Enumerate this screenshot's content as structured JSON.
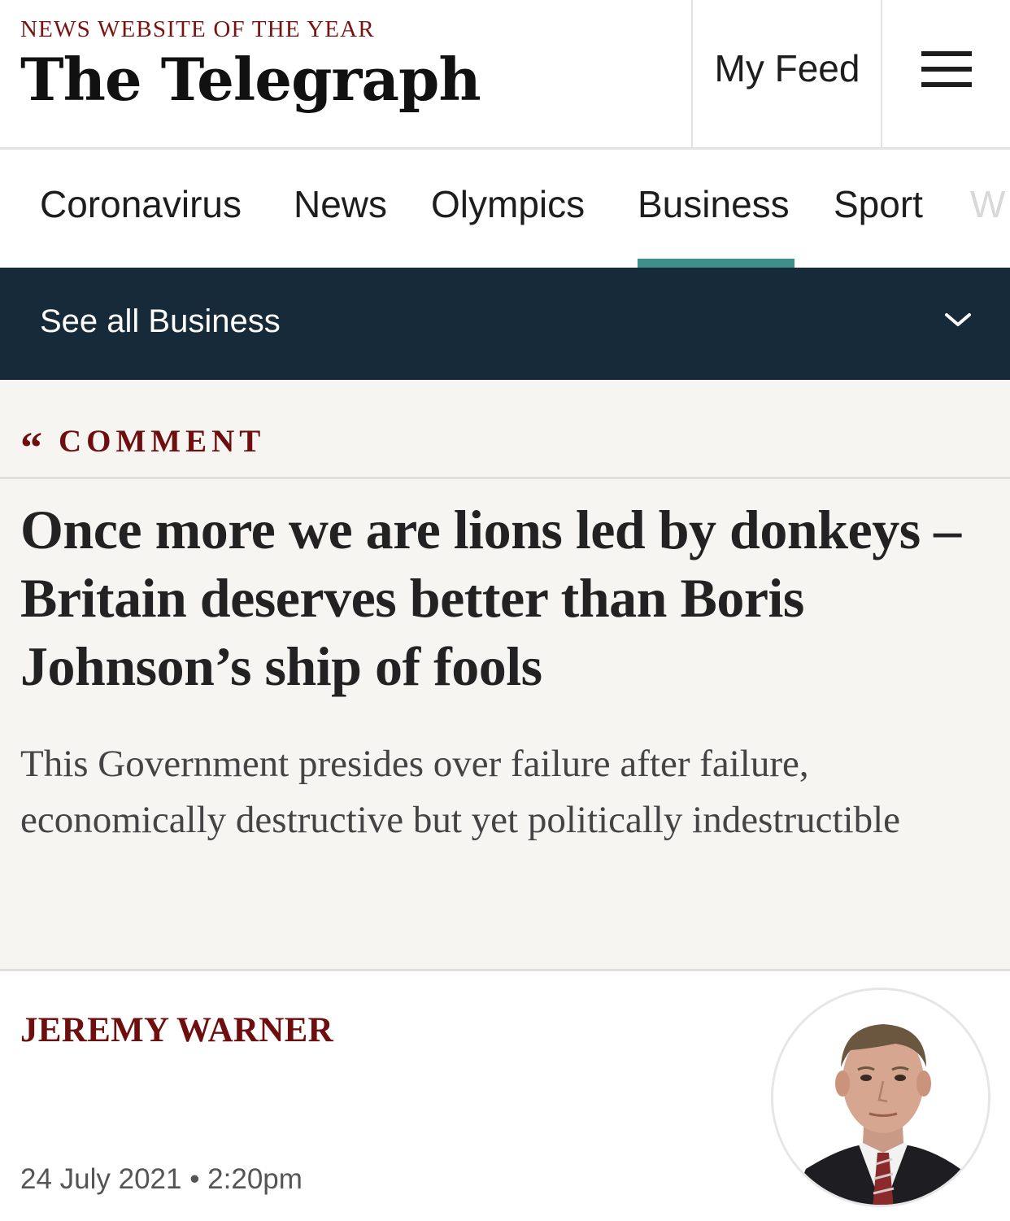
{
  "masthead": {
    "award": "NEWS WEBSITE OF THE YEAR",
    "logo_text": "The Telegraph",
    "my_feed_label": "My Feed",
    "menu_icon": "hamburger-menu-icon"
  },
  "primary_nav": {
    "items": [
      {
        "label": "Coronavirus"
      },
      {
        "label": "News"
      },
      {
        "label": "Olympics"
      },
      {
        "label": "Business"
      },
      {
        "label": "Sport"
      },
      {
        "label": "W"
      }
    ],
    "active": "Business",
    "accent_color": "#3f8f8a"
  },
  "subnav": {
    "label": "See all Business",
    "icon": "chevron-down-icon",
    "background_color": "#162a3a"
  },
  "article": {
    "kicker_icon": "quote-icon",
    "kicker_mark": "“",
    "kicker": "COMMENT",
    "headline": "Once more we are lions led by donkeys – Britain deserves better than Boris Johnson’s ship of fools",
    "standfirst": "This Government presides over failure after failure, economically destructive but yet politically indestructible",
    "author": "JEREMY WARNER",
    "date": "24 July 2021 • 2:20pm",
    "author_color": "#6e0e0e"
  }
}
